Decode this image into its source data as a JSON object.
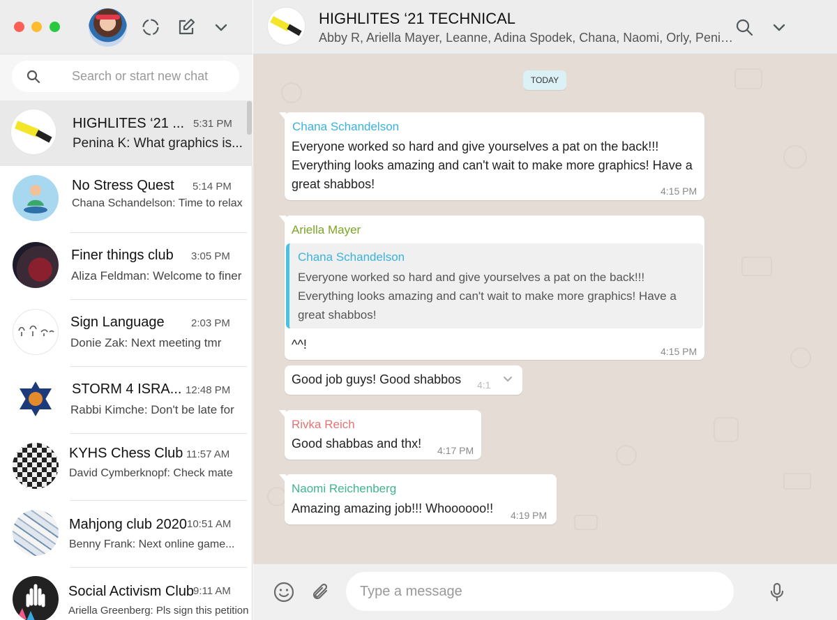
{
  "window": {
    "controls": [
      "close",
      "minimize",
      "zoom"
    ]
  },
  "sidebar": {
    "header": {
      "icons": [
        "profile-avatar",
        "status-icon",
        "new-chat-icon",
        "chevron-down-icon"
      ]
    },
    "search": {
      "placeholder": "Search or start new chat"
    },
    "chats": [
      {
        "name": "HIGHLITES ‘21 ...",
        "time": "5:31 PM",
        "preview": "Penina K: What graphics is...",
        "active": true
      },
      {
        "name": "No Stress Quest",
        "time": "5:14 PM",
        "preview": "Chana Schandelson: Time to relax"
      },
      {
        "name": "Finer things club",
        "time": "3:05 PM",
        "preview": "Aliza Feldman: Welcome to finer"
      },
      {
        "name": "Sign Language",
        "time": "2:03 PM",
        "preview": "Donie Zak: Next meeting tmr"
      },
      {
        "name": "STORM 4 ISRA...",
        "time": "12:48 PM",
        "preview": "Rabbi Kimche: Don't be late for"
      },
      {
        "name": "KYHS Chess Club",
        "time": "11:57 AM",
        "preview": "David Cymberknopf: Check mate"
      },
      {
        "name": "Mahjong club 2020",
        "time": "10:51 AM",
        "preview": "Benny Frank: Next online game..."
      },
      {
        "name": "Social Activism Club",
        "time": "9:11 AM",
        "preview": "Ariella Greenberg: Pls sign this petition"
      }
    ]
  },
  "conversation": {
    "title": "HIGHLITES ‘21 TECHNICAL",
    "members": "Abby R, Ariella Mayer, Leanne, Adina Spodek, Chana, Naomi, Orly, Penina...",
    "day_label": "TODAY",
    "messages": [
      {
        "sender": "Chana Schandelson",
        "sender_color": "#39b2dc",
        "text": "Everyone worked so hard and give yourselves a pat on the back!!! Everything looks amazing and can't wait to make more graphics! Have a great shabbos!",
        "time": "4:15 PM"
      },
      {
        "sender": "Ariella Mayer",
        "sender_color": "#7ba524",
        "quote": {
          "sender": "Chana Schandelson",
          "text": "Everyone worked so hard and give yourselves a pat on the back!!! Everything looks amazing and can't wait to make more graphics! Have a great shabbos!"
        },
        "text": "^^!",
        "time": "4:15 PM"
      },
      {
        "text": "Good job guys! Good shabbos",
        "time": "4:1"
      },
      {
        "sender": "Rivka Reich",
        "sender_color": "#e37474",
        "text": "Good shabbas and thx!",
        "time": "4:17 PM"
      },
      {
        "sender": "Naomi Reichenberg",
        "sender_color": "#3fb58f",
        "text": "Amazing amazing job!!! Whoooooo!!",
        "time": "4:19 PM"
      }
    ]
  },
  "composer": {
    "placeholder": "Type a message",
    "icons": [
      "emoji-icon",
      "attach-icon",
      "microphone-icon"
    ]
  }
}
